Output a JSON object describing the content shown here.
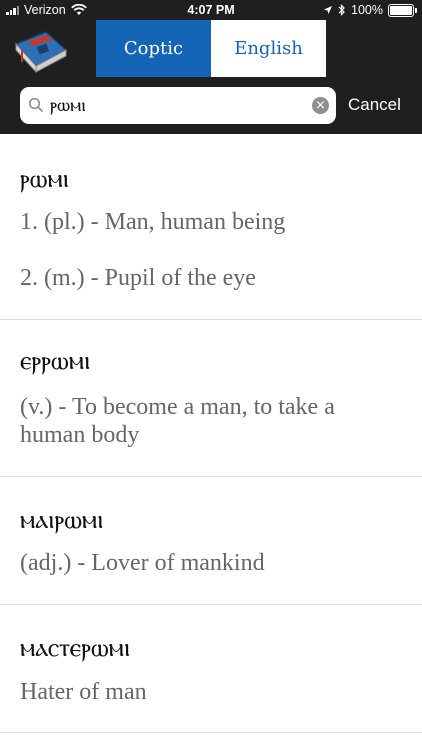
{
  "status_bar": {
    "carrier": "Verizon",
    "time": "4:07 PM",
    "battery": "100%"
  },
  "toolbar": {
    "tabs": [
      {
        "label": "Coptic",
        "active": true
      },
      {
        "label": "English",
        "active": false
      }
    ],
    "search": {
      "value": "ⲣⲱⲙⲓ"
    },
    "cancel_label": "Cancel"
  },
  "entries": [
    {
      "word": "ⲣⲱⲙⲓ",
      "definitions": [
        "1. (pl.) - Man, human being",
        "2. (m.) - Pupil of the eye"
      ]
    },
    {
      "word": "ⲉⲣⲣⲱⲙⲓ",
      "definitions": [
        "(v.) - To become a man, to take a human body"
      ]
    },
    {
      "word": "ⲙⲁⲓⲣⲱⲙⲓ",
      "definitions": [
        "(adj.) - Lover of mankind"
      ]
    },
    {
      "word": "ⲙⲁⲥⲧⲉⲣⲱⲙⲓ",
      "definitions": [
        "Hater of man"
      ]
    }
  ],
  "colors": {
    "accent": "#1565b7",
    "toolbar_bg": "#1f1f1f",
    "definition_text": "#666666"
  }
}
